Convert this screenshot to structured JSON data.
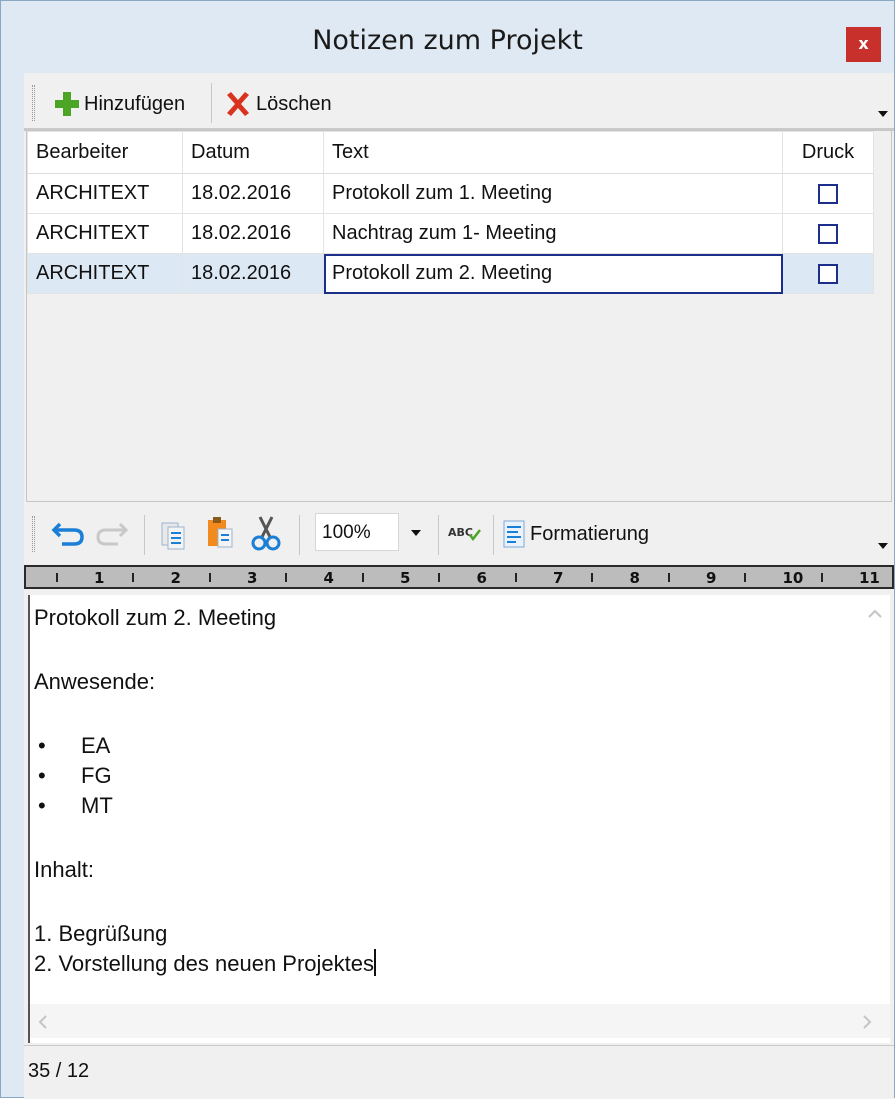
{
  "window": {
    "title": "Notizen zum Projekt",
    "close_label": "x"
  },
  "toolbar": {
    "add_label": "Hinzufügen",
    "delete_label": "Löschen"
  },
  "grid": {
    "headers": [
      "Bearbeiter",
      "Datum",
      "Text",
      "Druck"
    ],
    "rows": [
      {
        "bearbeiter": "ARCHITEXT",
        "datum": "18.02.2016",
        "text": "Protokoll zum 1. Meeting",
        "druck": false
      },
      {
        "bearbeiter": "ARCHITEXT",
        "datum": "18.02.2016",
        "text": "Nachtrag zum 1- Meeting",
        "druck": false
      },
      {
        "bearbeiter": "ARCHITEXT",
        "datum": "18.02.2016",
        "text": "Protokoll zum 2. Meeting",
        "druck": false
      }
    ],
    "selected_row": 3
  },
  "editor_toolbar": {
    "zoom": "100%",
    "spellcheck_label": "ABC",
    "format_label": "Formatierung"
  },
  "ruler": {
    "numbers": [
      "1",
      "2",
      "3",
      "4",
      "5",
      "6",
      "7",
      "8",
      "9",
      "10",
      "11"
    ]
  },
  "editor": {
    "line1": "Protokoll zum 2. Meeting",
    "line2": "Anwesende:",
    "bullets": [
      "EA",
      "FG",
      "MT"
    ],
    "bullet_char": "•",
    "line3": "Inhalt:",
    "item1": "1. Begrüßung",
    "item2": "2. Vorstellung des neuen Projektes"
  },
  "status": {
    "position": "35 / 12"
  },
  "colors": {
    "title_bg": "#dfe9f3",
    "close_red": "#c8312b",
    "add_green": "#4ca525",
    "delete_red": "#d9321f",
    "selection_blue": "#dde8f5",
    "focus_border": "#1b2f8a"
  }
}
